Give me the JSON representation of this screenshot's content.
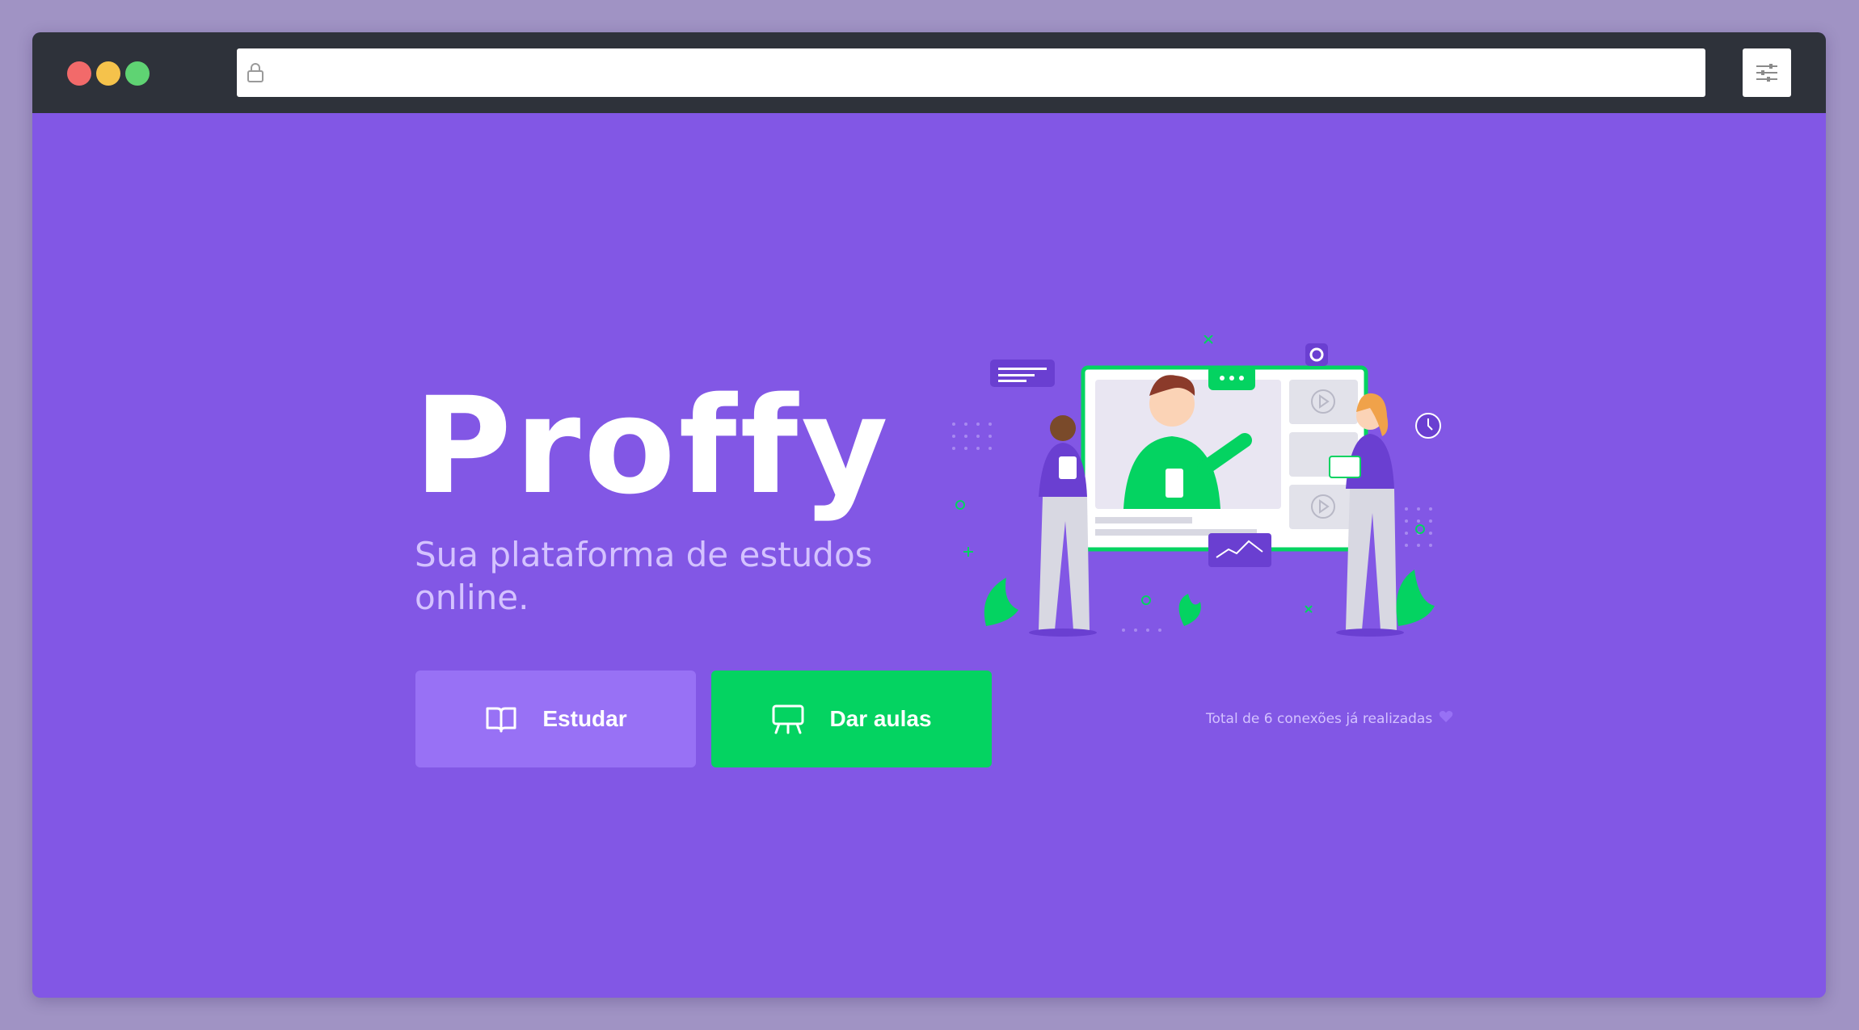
{
  "browser": {
    "address_value": "",
    "icons": [
      "lock-icon",
      "sliders-icon"
    ]
  },
  "landing": {
    "logo_text": "Proffy",
    "tagline": "Sua plataforma de estudos online.",
    "buttons": {
      "study_label": "Estudar",
      "study_icon": "book-icon",
      "teach_label": "Dar aulas",
      "teach_icon": "presentation-icon"
    },
    "connections_text": "Total de 6 conexões já realizadas",
    "connections_icon": "heart-icon"
  },
  "colors": {
    "background_purple": "#8257e5",
    "button_study": "#9871f5",
    "button_teach": "#04d361",
    "titlebar": "#2e323a",
    "tagline_text": "#d4c2ff"
  }
}
